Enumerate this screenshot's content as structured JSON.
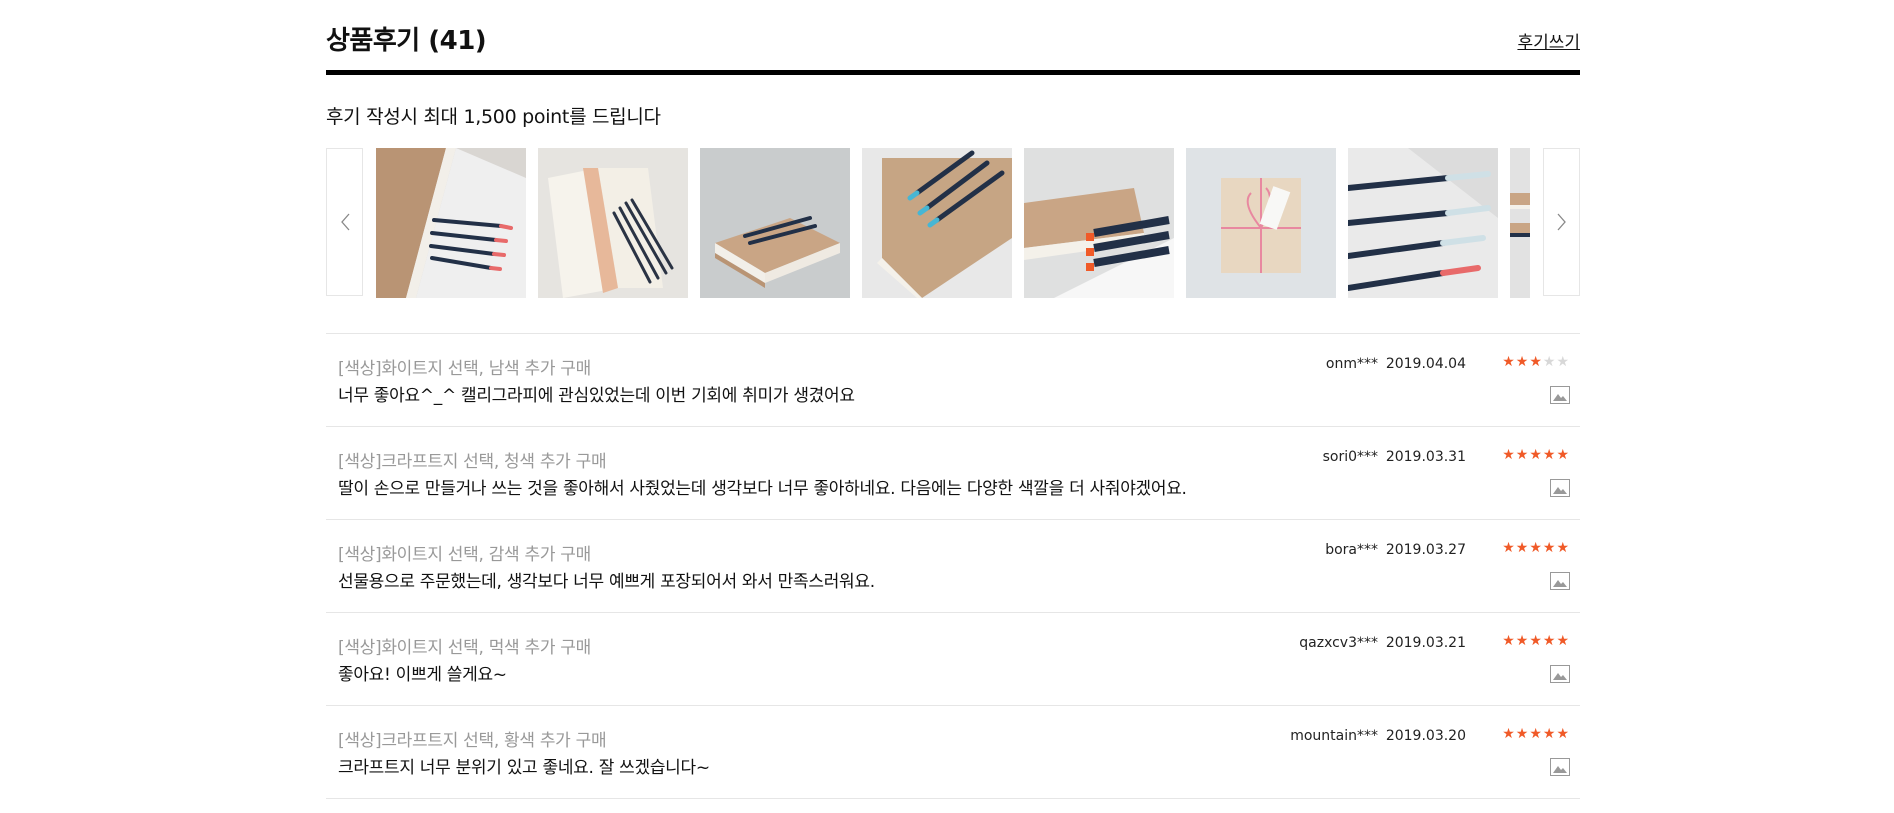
{
  "header": {
    "title": "상품후기 (41)",
    "write_label": "후기쓰기"
  },
  "notice": "후기 작성시 최대 1,500 point를 드립니다",
  "carousel": {
    "prev_icon": "chevron-left-icon",
    "next_icon": "chevron-right-icon",
    "thumbs": [
      "notebook-with-pens-photo",
      "open-notebook-with-pens-photo",
      "pens-on-notebooks-photo",
      "pens-on-kraft-notebooks-photo",
      "pens-beside-notebook-photo",
      "wrapped-gift-photo",
      "pens-in-row-photo",
      "partial-notebook-photo"
    ]
  },
  "reviews": [
    {
      "option": "[색상]화이트지 선택, 남색 추가 구매",
      "body": "너무 좋아요^_^ 캘리그라피에 관심있었는데 이번 기회에 취미가 생겼어요",
      "user": "onm***",
      "date": "2019.04.04",
      "rating": 3,
      "has_photo": true
    },
    {
      "option": "[색상]크라프트지 선택, 청색 추가 구매",
      "body": "딸이 손으로 만들거나 쓰는 것을 좋아해서 사줬었는데 생각보다 너무 좋아하네요. 다음에는 다양한 색깔을 더 사줘야겠어요.",
      "user": "sori0***",
      "date": "2019.03.31",
      "rating": 5,
      "has_photo": true
    },
    {
      "option": "[색상]화이트지 선택, 감색 추가 구매",
      "body": "선물용으로 주문했는데, 생각보다 너무 예쁘게 포장되어서 와서 만족스러워요.",
      "user": "bora***",
      "date": "2019.03.27",
      "rating": 5,
      "has_photo": true
    },
    {
      "option": "[색상]화이트지 선택, 먹색 추가 구매",
      "body": "좋아요! 이쁘게 쓸게요~",
      "user": "qazxcv3***",
      "date": "2019.03.21",
      "rating": 5,
      "has_photo": true
    },
    {
      "option": "[색상]크라프트지 선택, 황색 추가 구매",
      "body": "크라프트지 너무 분위기 있고 좋네요. 잘 쓰겠습니다~",
      "user": "mountain***",
      "date": "2019.03.20",
      "rating": 5,
      "has_photo": true
    }
  ],
  "colors": {
    "star_on": "#f05a28",
    "star_off": "#d8d8d8",
    "divider": "#e6e6e6",
    "option_text": "#999999"
  }
}
